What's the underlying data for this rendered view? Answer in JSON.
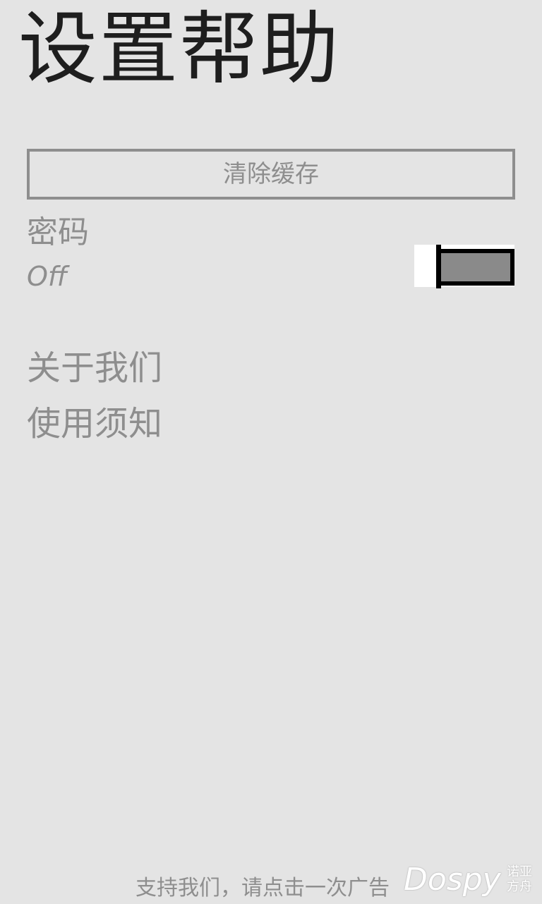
{
  "header": {
    "title": "设置帮助"
  },
  "settings": {
    "clear_cache_label": "清除缓存",
    "password": {
      "label": "密码",
      "state": "Off",
      "enabled": false
    },
    "menu": [
      {
        "label": "关于我们"
      },
      {
        "label": "使用须知"
      }
    ]
  },
  "footer": {
    "ad_text": "支持我们，请点击一次广告"
  },
  "watermark": {
    "brand": "Dospy",
    "sub_line1": "诺亚",
    "sub_line2": "方舟"
  },
  "colors": {
    "background": "#e4e4e4",
    "title_text": "#1e1e1e",
    "secondary_text": "#8e8e8e",
    "toggle_fill": "#8a8a8a",
    "toggle_border": "#000000"
  }
}
